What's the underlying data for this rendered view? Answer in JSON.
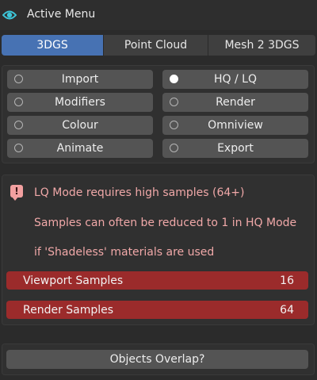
{
  "header": {
    "title": "Active Menu",
    "icon": "eye-icon",
    "accent": "#3dc5d8"
  },
  "tabs": [
    {
      "label": "3DGS",
      "active": true
    },
    {
      "label": "Point Cloud",
      "active": false
    },
    {
      "label": "Mesh 2 3DGS",
      "active": false
    }
  ],
  "menu": {
    "left": [
      {
        "label": "Import",
        "selected": false
      },
      {
        "label": "Modifiers",
        "selected": false
      },
      {
        "label": "Colour",
        "selected": false
      },
      {
        "label": "Animate",
        "selected": false
      }
    ],
    "right": [
      {
        "label": "HQ / LQ",
        "selected": true
      },
      {
        "label": "Render",
        "selected": false
      },
      {
        "label": "Omniview",
        "selected": false
      },
      {
        "label": "Export",
        "selected": false
      }
    ]
  },
  "warning": {
    "icon": "info-alert-icon",
    "lines": [
      "LQ Mode requires high samples (64+)",
      "Samples can often be reduced to 1 in HQ Mode",
      "if 'Shadeless' materials are used"
    ],
    "color": "#f0a8a8"
  },
  "samples": {
    "viewport": {
      "label": "Viewport Samples",
      "value": "16"
    },
    "render": {
      "label": "Render Samples",
      "value": "64"
    },
    "color": "#9b2b2b"
  },
  "actions": {
    "overlap_label": "Objects Overlap?"
  }
}
